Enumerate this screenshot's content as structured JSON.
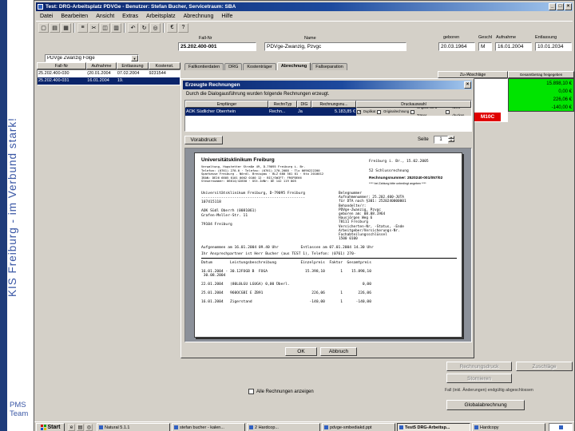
{
  "slide": {
    "vertical_text": "KIS Freiburg - im Verbund stark!",
    "footer": [
      "PMS",
      "Team"
    ]
  },
  "window": {
    "title": "Test: DRG-Arbeitsplatz PDVGe - Benutzer: Stefan Bucher, Servicetraum: SBA",
    "controls": {
      "min": "_",
      "max": "□",
      "close": "×"
    },
    "menu": [
      "Datei",
      "Bearbeiten",
      "Ansicht",
      "Extras",
      "Arbeitsplatz",
      "Abrechnung",
      "Hilfe"
    ],
    "toolbar_icons": [
      {
        "name": "new-doc-icon",
        "glyph": "▢"
      },
      {
        "name": "open-folder-icon",
        "glyph": "▤"
      },
      {
        "name": "save-icon",
        "glyph": "▦"
      },
      {
        "name": "print-icon",
        "glyph": "≡"
      },
      {
        "name": "cut-icon",
        "glyph": "✂"
      },
      {
        "name": "copy-icon",
        "glyph": "◫"
      },
      {
        "name": "paste-icon",
        "glyph": "▥"
      },
      {
        "name": "undo-icon",
        "glyph": "↶"
      },
      {
        "name": "refresh-icon",
        "glyph": "↻"
      },
      {
        "name": "search-icon",
        "glyph": "◎"
      },
      {
        "name": "euro-icon",
        "glyph": "€"
      },
      {
        "name": "help-icon",
        "glyph": "?"
      }
    ]
  },
  "patient": {
    "fall_nr_label": "Fall-Nr",
    "fall_nr": "25.202.400-001",
    "name_label": "Name",
    "name": "PDVge-Zwanzig, Pzvgc",
    "geboren_label": "geboren",
    "geboren": "20.03.1964",
    "geschl_label": "Geschl",
    "geschl": "M",
    "aufnahme_label": "Aufnahme",
    "aufnahme": "16.01.2004",
    "entlassung_label": "Entlassung",
    "entlassung": "10.01.2034"
  },
  "case_panel": {
    "dropdown_value": "PDVge Zwanzig Folge",
    "columns": [
      "Fall-Nr",
      "Aufnahme",
      "Entlassung",
      "Kostenst."
    ],
    "rows": [
      {
        "fall": "25.202.400-030",
        "aufn": "(20.01.2004",
        "entl": "07.02.2004",
        "kost": "9231544"
      },
      {
        "fall": "25.202.400-031",
        "aufn": "16.01.2004",
        "entl": "19.",
        "kost": ""
      }
    ]
  },
  "tabs": [
    "Fallkontierdaten",
    "DRG",
    "Kostenträger",
    "Abrechnung",
    "Fallseparation"
  ],
  "totals": {
    "col1_header": "Zu-/Abschläge",
    "col2_header": "Gesamtbetrag freigegeben",
    "values": [
      "15.898,10 €",
      "0,00 €",
      "226,06 €",
      "-140,00 €"
    ],
    "flag": "M10C"
  },
  "dialog": {
    "title": "Erzeugte Rechnungen",
    "close": "×",
    "instruction": "Durch die Dialogausführung wurden folgende Rechnungen erzeugt.",
    "grid_headers": [
      "Empfänger",
      "RechnTyp",
      "DIG",
      "Rechnungsnu...",
      "Druckauswahl"
    ],
    "row": {
      "empfaenger": "AOK Südlicher Oberrhein",
      "typ": "Rechn...",
      "dig": "Ja",
      "betrag": "5.183,85 €"
    },
    "print_options": [
      "Duplikat",
      "Originalrechnung",
      "Original mit Ü-Träger",
      "Nicht drucken"
    ],
    "vorabdruck_label": "Vorabdruck",
    "seite_label": "Seite",
    "seite_value": "1",
    "ok_label": "OK",
    "cancel_label": "Abbruch"
  },
  "invoice": {
    "hospital": "Universitätsklinikum Freiburg",
    "header_block": "Verwaltung, Hugstetter Straße 49, D-79095 Freiburg i. Br.\nTelefon: (0761) 270-0 · Telefax: (0761) 270-2088 · Tlx 0690222200\nSparkasse Freiburg - Nördl. Breisgau · BLZ 680 501 01 · Kto 2010012\nIBAN: DE26 6805 0101 0002 0100 12 · BIC/SWIFT: FRSPDE66\nSteuernummer: 06614/42850 · USt-IdNr: DE 142 119 805",
    "right_block": "Freiburg i. Br., 15.02.2005\n\n52 Schlussrechnung",
    "rechnung_label": "Rechnungsnummer: 2520240-001/057/02",
    "rechnung_note": "**** bei Zahlung bitte unbedingt angeben ****",
    "address_block": "Universitätsklinikum Freiburg, D-79095 Freiburg\n-----------------------------------------------\n107415118\n\nAOK Südl Oberrh (0081061)\nGrafen-Meller-Str. 11\n\n79104 Freiburg",
    "meta_block": "Belegnummer\nAufnahmenummer: 25.202.400-JUTA\nfür DTA nach §301: 2520240000001\nBehandelte/r:\nPDVge-Zwanzig, Pzvgc\ngeboren am: 08.08.1964\nHausjörgen Weg 6\n78111 Freiburg\nVersicherten-Nr, -Status, -Ende\nArbeitgeber/Versicherungs-Nr.\nFachabteilungsschlüssel\n1500 0100",
    "period_line": "Aufgenommen am 16.01.2004 09.40 Uhr          Entlassen am 07.01.2004 14.30 Uhr",
    "contact_line": "Ihr Ansprechpartner ist Herr Bucher (aus TEST 1), Telefon: (0761) 270-",
    "table_block": "Datum        Leistungsbeschreibung           Einzelpreis  Faktor  Gesamtpreis\n\n16.01.2004 - 30.12FOGB B  FOGA                 15.398,10       1    15.898,10\n 30.08.2004\n\n22.01.2004   (80L0LGU LGUGA) 0,00 Überl.                                 0,00\n\n25.01.2004   960OCGBI E ZB91                      226,06       1       226,06\n\n16.01.2004   Zigerstand                          -140,00       1      -140,00"
  },
  "bottom": {
    "buttons": [
      "Rechnungsdruck",
      "Zuschläge",
      "Stornieren"
    ],
    "show_all_label": "Alle Rechnungen anzeigen",
    "final_note": "Fall (inkl. Änderungen) endgültig abgeschlossen",
    "global_label": "Globalabrechnung"
  },
  "taskbar": {
    "start_label": "Start",
    "quicklaunch": [
      "e",
      "▤",
      "◎"
    ],
    "tasks": [
      "Natural 5.1.1",
      "stefan bucher - kalen...",
      "2 Hardcop...",
      "pdvge-smbediakd.ppt",
      "Test5 DRG-Arbeitsp...",
      "Hardcopy"
    ]
  }
}
